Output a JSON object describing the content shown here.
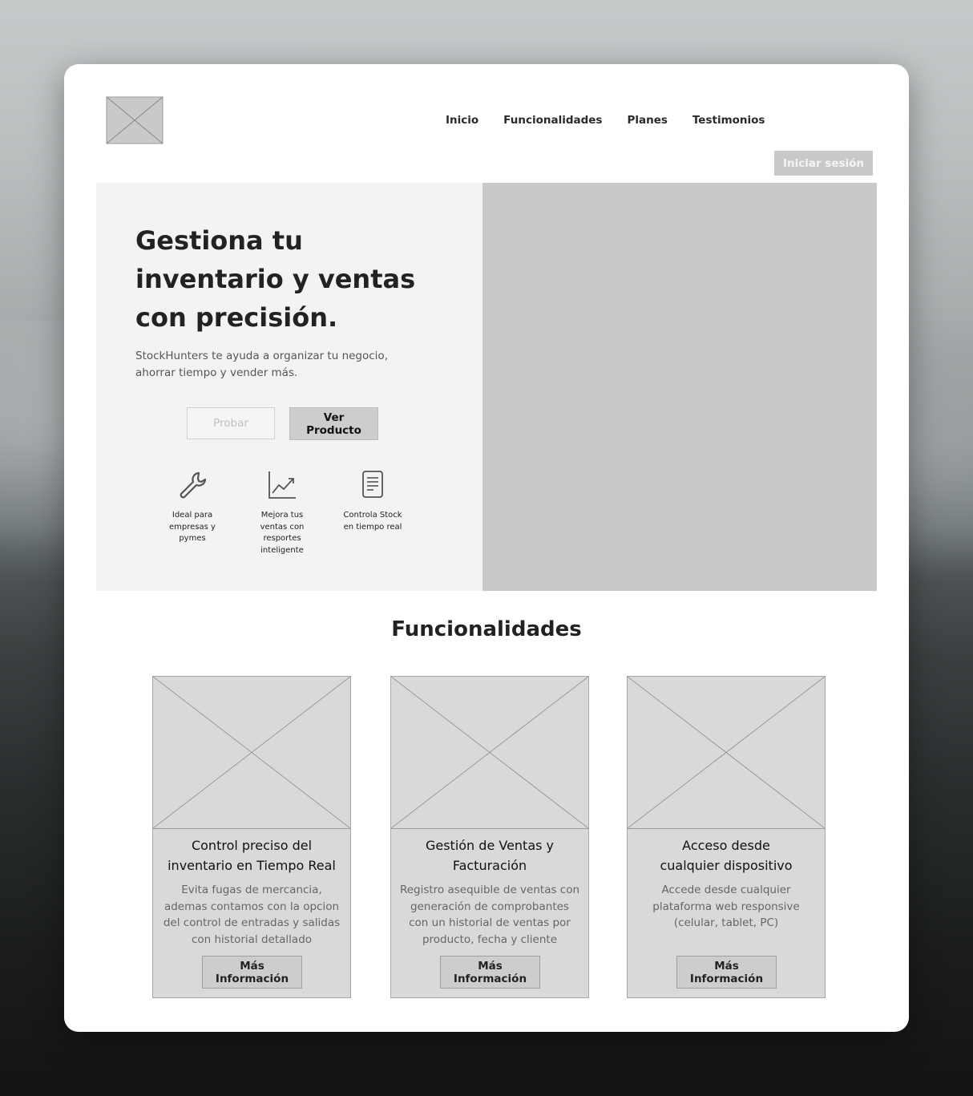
{
  "header": {
    "logo": "logo-placeholder",
    "nav": [
      "Inicio",
      "Funcionalidades",
      "Planes",
      "Testimonios"
    ],
    "login_label": "Iniciar sesión"
  },
  "hero": {
    "title_lines": [
      "Gestiona tu",
      "inventario y ventas",
      "con precisión."
    ],
    "subtitle_lines": [
      "StockHunters te ayuda a organizar tu negocio,",
      "ahorrar tiempo y vender más."
    ],
    "try_label": "Probar",
    "view_label": "Ver Producto",
    "features": [
      {
        "icon": "wrench-icon",
        "lines": [
          "Ideal para",
          "empresas y",
          "pymes"
        ]
      },
      {
        "icon": "chart-icon",
        "lines": [
          "Mejora tus",
          "ventas con",
          "resportes",
          "inteligente"
        ]
      },
      {
        "icon": "document-icon",
        "lines": [
          "Controla Stock",
          "en tiempo real"
        ]
      }
    ]
  },
  "features_section": {
    "title": "Funcionalidades",
    "cards": [
      {
        "title_lines": [
          "Control preciso del",
          "inventario en Tiempo Real"
        ],
        "desc_lines": [
          "Evita fugas de mercancia,",
          "ademas contamos con la opcion",
          "del control de entradas y salidas",
          "con historial detallado"
        ],
        "button": "Más Información"
      },
      {
        "title_lines": [
          "Gestión de Ventas y",
          "Facturación"
        ],
        "desc_lines": [
          "Registro asequible de ventas con",
          "generación de comprobantes",
          "con un historial de ventas por",
          "producto, fecha y cliente"
        ],
        "button": "Más Información"
      },
      {
        "title_lines": [
          "Acceso desde",
          "cualquier dispositivo"
        ],
        "desc_lines": [
          "Accede desde cualquier",
          "plataforma web responsive",
          "(celular, tablet, PC)"
        ],
        "button": "Más Información"
      }
    ]
  },
  "colors": {
    "placeholder": "#c9c9c9",
    "card": "#d9d9d9",
    "hero_bg": "#f3f3f3",
    "text": "#222222"
  }
}
